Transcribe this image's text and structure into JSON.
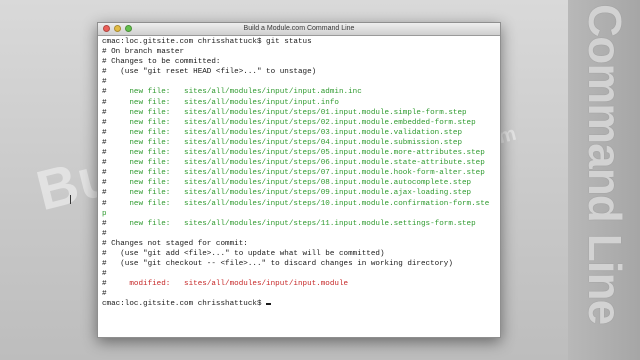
{
  "background": {
    "watermark_logo": "Build",
    "watermark_sub": ".com",
    "side_title": "Command Line"
  },
  "window": {
    "title": "Build a Module.com Command Line"
  },
  "terminal": {
    "lines": [
      {
        "text": "cmac:loc.gitsite.com chrisshattuck$ git status",
        "style": ""
      },
      {
        "text": "# On branch master",
        "style": ""
      },
      {
        "text": "# Changes to be committed:",
        "style": ""
      },
      {
        "text": "#   (use \"git reset HEAD <file>...\" to unstage)",
        "style": ""
      },
      {
        "text": "#",
        "style": ""
      },
      {
        "prefix": "#",
        "text": "\tnew file:   sites/all/modules/input/input.admin.inc",
        "style": "green"
      },
      {
        "prefix": "#",
        "text": "\tnew file:   sites/all/modules/input/input.info",
        "style": "green"
      },
      {
        "prefix": "#",
        "text": "\tnew file:   sites/all/modules/input/steps/01.input.module.simple-form.step",
        "style": "green"
      },
      {
        "prefix": "#",
        "text": "\tnew file:   sites/all/modules/input/steps/02.input.module.embedded-form.step",
        "style": "green"
      },
      {
        "prefix": "#",
        "text": "\tnew file:   sites/all/modules/input/steps/03.input.module.validation.step",
        "style": "green"
      },
      {
        "prefix": "#",
        "text": "\tnew file:   sites/all/modules/input/steps/04.input.module.submission.step",
        "style": "green"
      },
      {
        "prefix": "#",
        "text": "\tnew file:   sites/all/modules/input/steps/05.input.module.more-attributes.step",
        "style": "green"
      },
      {
        "prefix": "#",
        "text": "\tnew file:   sites/all/modules/input/steps/06.input.module.state-attribute.step",
        "style": "green"
      },
      {
        "prefix": "#",
        "text": "\tnew file:   sites/all/modules/input/steps/07.input.module.hook-form-alter.step",
        "style": "green"
      },
      {
        "prefix": "#",
        "text": "\tnew file:   sites/all/modules/input/steps/08.input.module.autocomplete.step",
        "style": "green"
      },
      {
        "prefix": "#",
        "text": "\tnew file:   sites/all/modules/input/steps/09.input.module.ajax-loading.step",
        "style": "green"
      },
      {
        "prefix": "#",
        "text": "\tnew file:   sites/all/modules/input/steps/10.input.module.confirmation-form.ste",
        "style": "green"
      },
      {
        "text": "p",
        "style": "green"
      },
      {
        "prefix": "#",
        "text": "\tnew file:   sites/all/modules/input/steps/11.input.module.settings-form.step",
        "style": "green"
      },
      {
        "text": "#",
        "style": ""
      },
      {
        "text": "# Changes not staged for commit:",
        "style": ""
      },
      {
        "text": "#   (use \"git add <file>...\" to update what will be committed)",
        "style": ""
      },
      {
        "text": "#   (use \"git checkout -- <file>...\" to discard changes in working directory)",
        "style": ""
      },
      {
        "text": "#",
        "style": ""
      },
      {
        "prefix": "#",
        "text": "\tmodified:   sites/all/modules/input/input.module",
        "style": "red"
      },
      {
        "text": "#",
        "style": ""
      },
      {
        "text": "cmac:loc.gitsite.com chrisshattuck$ ",
        "style": "",
        "cursor": true
      }
    ]
  }
}
